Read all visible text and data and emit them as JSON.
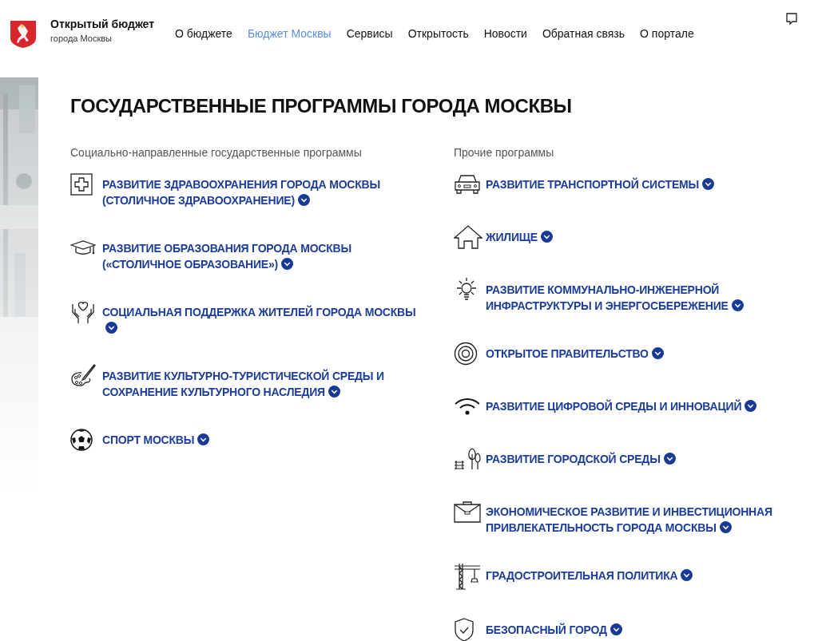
{
  "header": {
    "title": "Открытый бюджет",
    "subtitle": "города Москвы"
  },
  "nav": [
    {
      "label": "О бюджете",
      "selected": false
    },
    {
      "label": "Бюджет Москвы",
      "selected": true
    },
    {
      "label": "Сервисы",
      "selected": false
    },
    {
      "label": "Открытость",
      "selected": false
    },
    {
      "label": "Новости",
      "selected": false
    },
    {
      "label": "Обратная связь",
      "selected": false
    },
    {
      "label": "О портале",
      "selected": false
    }
  ],
  "page_title": "ГОСУДАРСТВЕННЫЕ ПРОГРАММЫ ГОРОДА МОСКВЫ",
  "columns": [
    {
      "heading": "Социально-направленные государственные программы",
      "programs": [
        {
          "title": "РАЗВИТИЕ ЗДРАВООХРАНЕНИЯ ГОРОДА МОСКВЫ (СТОЛИЧНОЕ ЗДРАВООХРАНЕНИЕ)"
        },
        {
          "title": "РАЗВИТИЕ ОБРАЗОВАНИЯ ГОРОДА МОСКВЫ («СТОЛИЧНОЕ ОБРАЗОВАНИЕ»)"
        },
        {
          "title": "СОЦИАЛЬНАЯ ПОДДЕРЖКА ЖИТЕЛЕЙ ГОРОДА МОСКВЫ"
        },
        {
          "title": "РАЗВИТИЕ КУЛЬТУРНО-ТУРИСТИЧЕСКОЙ СРЕДЫ И СОХРАНЕНИЕ КУЛЬТУРНОГО НАСЛЕДИЯ"
        },
        {
          "title": "СПОРТ МОСКВЫ"
        }
      ]
    },
    {
      "heading": "Прочие программы",
      "programs": [
        {
          "title": "РАЗВИТИЕ ТРАНСПОРТНОЙ СИСТЕМЫ"
        },
        {
          "title": "ЖИЛИЩЕ"
        },
        {
          "title": "РАЗВИТИЕ КОММУНАЛЬНО-ИНЖЕНЕРНОЙ ИНФРАСТРУКТУРЫ И ЭНЕРГОСБЕРЕЖЕНИЕ"
        },
        {
          "title": "ОТКРЫТОЕ ПРАВИТЕЛЬСТВО"
        },
        {
          "title": "РАЗВИТИЕ ЦИФРОВОЙ СРЕДЫ И ИННОВАЦИЙ"
        },
        {
          "title": "РАЗВИТИЕ ГОРОДСКОЙ СРЕДЫ"
        },
        {
          "title": "ЭКОНОМИЧЕСКОЕ РАЗВИТИЕ И ИНВЕСТИЦИОННАЯ ПРИВЛЕКАТЕЛЬНОСТЬ ГОРОДА МОСКВЫ"
        },
        {
          "title": "ГРАДОСТРОИТЕЛЬНАЯ ПОЛИТИКА"
        },
        {
          "title": "БЕЗОПАСНЫЙ ГОРОД"
        }
      ]
    }
  ]
}
